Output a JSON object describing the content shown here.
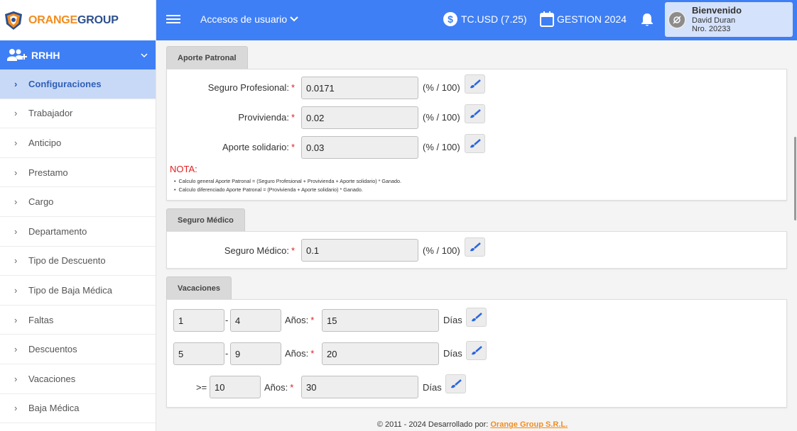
{
  "brand": {
    "part1": "ORANGE",
    "part2": "GROUP"
  },
  "sidebar": {
    "module_label": "RRHH",
    "items": [
      {
        "label": "Configuraciones",
        "active": true
      },
      {
        "label": "Trabajador"
      },
      {
        "label": "Anticipo"
      },
      {
        "label": "Prestamo"
      },
      {
        "label": "Cargo"
      },
      {
        "label": "Departamento"
      },
      {
        "label": "Tipo de Descuento"
      },
      {
        "label": "Tipo de Baja Médica"
      },
      {
        "label": "Faltas"
      },
      {
        "label": "Descuentos"
      },
      {
        "label": "Vacaciones"
      },
      {
        "label": "Baja Médica"
      }
    ]
  },
  "header": {
    "menu_label": "Accesos de usuario",
    "exchange_rate": "TC.USD (7.25)",
    "gestion": "GESTION 2024",
    "user": {
      "greeting": "Bienvenido",
      "name": "David Duran",
      "number": "Nro. 20233"
    }
  },
  "aporte_patronal": {
    "title": "Aporte Patronal",
    "fields": [
      {
        "label": "Seguro Profesional:",
        "value": "0.0171",
        "unit": "(% / 100)"
      },
      {
        "label": "Provivienda:",
        "value": "0.02",
        "unit": "(% / 100)"
      },
      {
        "label": "Aporte solidario:",
        "value": "0.03",
        "unit": "(% / 100)"
      }
    ],
    "nota_title": "NOTA:",
    "notes": [
      "Calculo general Aporte Patronal = (Seguro Profesional + Provivienda + Aporte solidario) * Ganado.",
      "Calculo diferenciado Aporte Patronal = (Provivienda + Aporte solidario) * Ganado."
    ]
  },
  "seguro_medico": {
    "title": "Seguro Médico",
    "label": "Seguro Médico:",
    "value": "0.1",
    "unit": "(% / 100)"
  },
  "vacaciones": {
    "title": "Vacaciones",
    "years_label": "Años:",
    "days_label": "Días",
    "range_sep": "-",
    "ge_label": ">=",
    "rows": [
      {
        "from": "1",
        "to": "4",
        "days": "15"
      },
      {
        "from": "5",
        "to": "9",
        "days": "20"
      },
      {
        "from": "10",
        "days": "30"
      }
    ]
  },
  "footer": {
    "text": "© 2011 - 2024 Desarrollado por:",
    "link": "Orange Group S.R.L."
  },
  "colors": {
    "primary": "#3f7ff5",
    "accent": "#f28c1e",
    "required": "#e02020"
  }
}
